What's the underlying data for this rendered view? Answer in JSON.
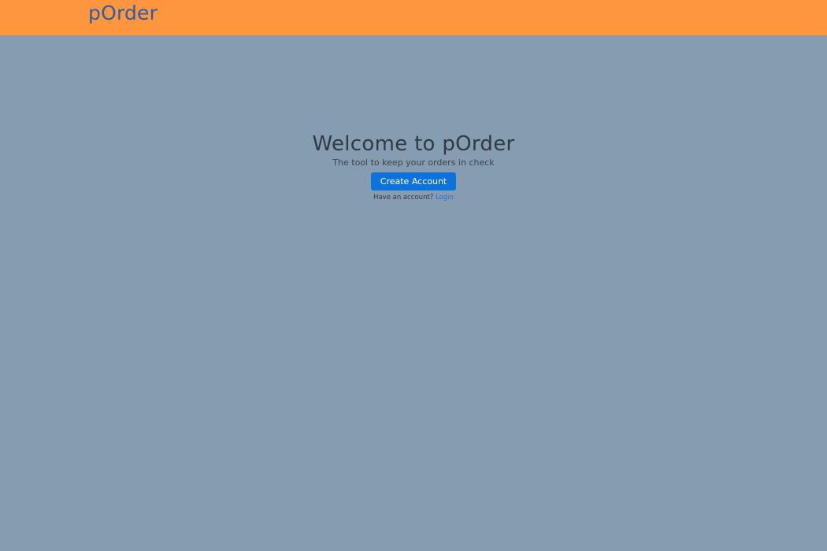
{
  "header": {
    "brand": "pOrder"
  },
  "hero": {
    "title": "Welcome to pOrder",
    "tagline": "The tool to keep your orders in check",
    "create_account_label": "Create Account",
    "have_account_text": "Have an account?",
    "login_label": "Login"
  },
  "colors": {
    "header_bg": "#fe953f",
    "page_bg": "#869db1",
    "brand_text": "#2f5da8",
    "button_bg": "#0e72db",
    "link": "#1f6fd6"
  }
}
